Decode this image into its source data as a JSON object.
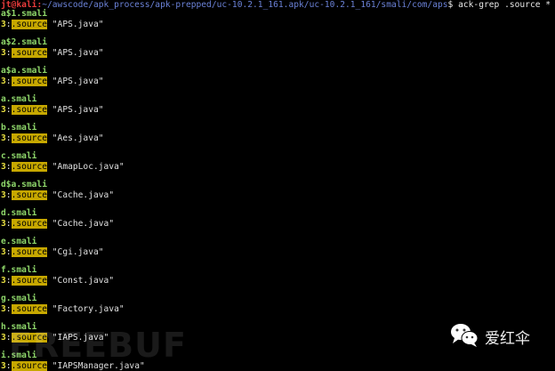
{
  "terminal": {
    "prompt": {
      "user_host": "jt@kali",
      "separator": ":",
      "cwd": "~/awscode/apk_process/apk-prepped/uc-10.2.1_161.apk/uc-10.2.1_161/smali/com/aps",
      "symbol": "$",
      "command": " ack-grep .source *"
    },
    "results": [
      {
        "file": "a$1.smali",
        "lineno": "3",
        "colon": ":",
        "keyword": ".source",
        "value": "\"APS.java\""
      },
      {
        "file": "a$2.smali",
        "lineno": "3",
        "colon": ":",
        "keyword": ".source",
        "value": "\"APS.java\""
      },
      {
        "file": "a$a.smali",
        "lineno": "3",
        "colon": ":",
        "keyword": ".source",
        "value": "\"APS.java\""
      },
      {
        "file": "a.smali",
        "lineno": "3",
        "colon": ":",
        "keyword": ".source",
        "value": "\"APS.java\""
      },
      {
        "file": "b.smali",
        "lineno": "3",
        "colon": ":",
        "keyword": ".source",
        "value": "\"Aes.java\""
      },
      {
        "file": "c.smali",
        "lineno": "3",
        "colon": ":",
        "keyword": ".source",
        "value": "\"AmapLoc.java\""
      },
      {
        "file": "d$a.smali",
        "lineno": "3",
        "colon": ":",
        "keyword": ".source",
        "value": "\"Cache.java\""
      },
      {
        "file": "d.smali",
        "lineno": "3",
        "colon": ":",
        "keyword": ".source",
        "value": "\"Cache.java\""
      },
      {
        "file": "e.smali",
        "lineno": "3",
        "colon": ":",
        "keyword": ".source",
        "value": "\"Cgi.java\""
      },
      {
        "file": "f.smali",
        "lineno": "3",
        "colon": ":",
        "keyword": ".source",
        "value": "\"Const.java\""
      },
      {
        "file": "g.smali",
        "lineno": "3",
        "colon": ":",
        "keyword": ".source",
        "value": "\"Factory.java\""
      },
      {
        "file": "h.smali",
        "lineno": "3",
        "colon": ":",
        "keyword": ".source",
        "value": "\"IAPS.java\""
      },
      {
        "file": "i.smali",
        "lineno": "3",
        "colon": ":",
        "keyword": ".source",
        "value": "\"IAPSManager.java\""
      }
    ]
  },
  "overlay": {
    "watermark_text": "FREEBUF",
    "wechat_icon": "wechat-icon",
    "account_name": "爱红伞"
  },
  "colors": {
    "background": "#000000",
    "user_host": "#e83b3b",
    "cwd": "#6b82d8",
    "filename": "#8ed66a",
    "lineno": "#e8e040",
    "highlight": "#c7a800"
  }
}
